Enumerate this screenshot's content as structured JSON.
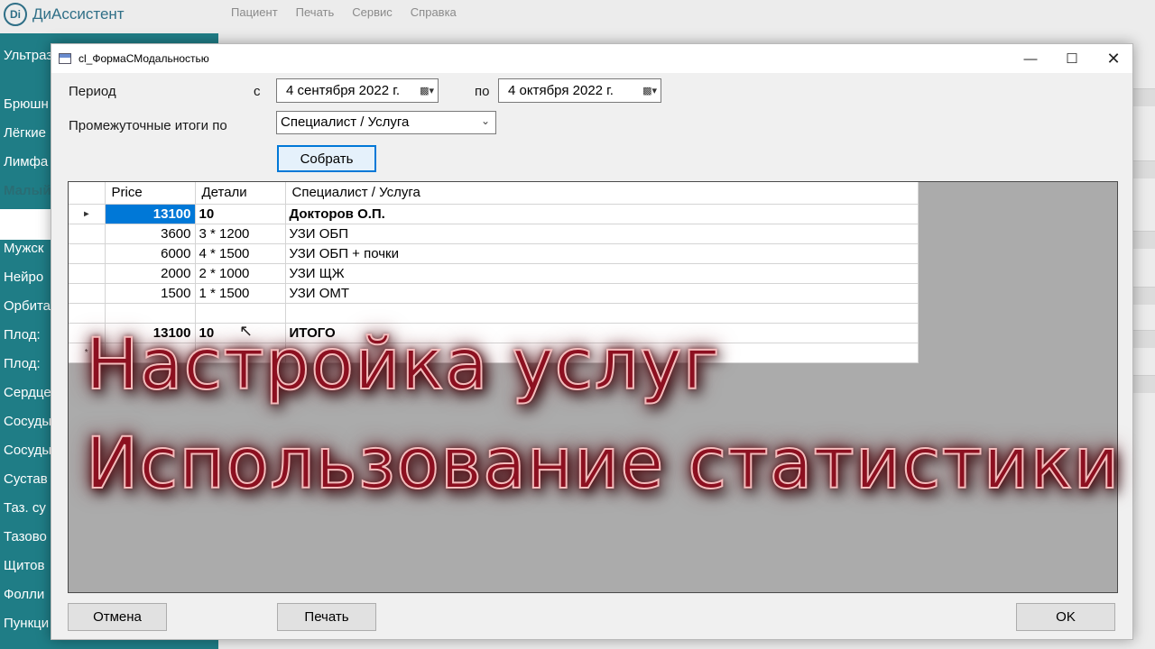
{
  "app": {
    "name": "ДиАссистент",
    "logo": "Di",
    "menu": [
      "Пациент",
      "Печать",
      "Сервис",
      "Справка"
    ]
  },
  "bg_sidebar": {
    "items": [
      "Ультраз",
      "Брюшн",
      "Лёгкие",
      "Лимфа",
      "Малый",
      "Молоч",
      "Мужск",
      "Нейро",
      "Орбита",
      "Плод:",
      "Плод:",
      "Сердце",
      "Сосуды",
      "Сосуды",
      "Сустав",
      "Таз. су",
      "Тазово",
      "Щитов",
      "Фолли",
      "Пункци"
    ]
  },
  "dialog": {
    "title": "cl_ФормаСМодальностью",
    "period_label": "Период",
    "from_label": "с",
    "from_date": "4 сентября 2022 г.",
    "to_label": "по",
    "to_date": "4  октября  2022 г.",
    "subtotals_label": "Промежуточные итоги по",
    "subtotals_value": "Специалист / Услуга",
    "collect_button": "Собрать",
    "cancel_button": "Отмена",
    "print_button": "Печать",
    "ok_button": "OK"
  },
  "grid": {
    "columns": [
      "Price",
      "Детали",
      "Специалист / Услуга"
    ],
    "rows": [
      {
        "marker": "▸",
        "price": "13100",
        "details": "10",
        "name": "Докторов О.П."
      },
      {
        "marker": "",
        "price": "3600",
        "details": "3 * 1200",
        "name": "УЗИ ОБП"
      },
      {
        "marker": "",
        "price": "6000",
        "details": "4 * 1500",
        "name": "УЗИ ОБП + почки"
      },
      {
        "marker": "",
        "price": "2000",
        "details": "2 * 1000",
        "name": "УЗИ ЩЖ"
      },
      {
        "marker": "",
        "price": "1500",
        "details": "1 * 1500",
        "name": "УЗИ ОМТ"
      },
      {
        "marker": "",
        "price": "",
        "details": "",
        "name": ""
      },
      {
        "marker": "",
        "price": "13100",
        "details": "10",
        "name": "ИТОГО"
      },
      {
        "marker": "*",
        "price": "",
        "details": "",
        "name": ""
      }
    ]
  },
  "overlay": {
    "line1": "Настройка услуг",
    "line2": "Использование статистики"
  }
}
